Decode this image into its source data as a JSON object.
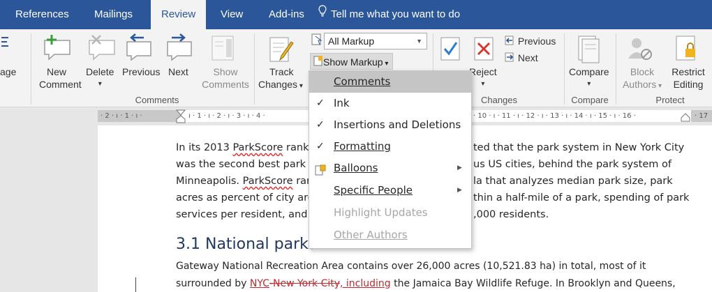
{
  "tabs": [
    {
      "label": "References",
      "active": false
    },
    {
      "label": "Mailings",
      "active": false
    },
    {
      "label": "Review",
      "active": true
    },
    {
      "label": "View",
      "active": false
    },
    {
      "label": "Add-ins",
      "active": false
    }
  ],
  "tell_me": "Tell me what you want to do",
  "ribbon": {
    "page_partial": "age",
    "new_comment": [
      "New",
      "Comment"
    ],
    "delete": "Delete",
    "previous": "Previous",
    "next": "Next",
    "show_comments": [
      "Show",
      "Comments"
    ],
    "comments_group": "Comments",
    "track_changes": [
      "Track",
      "Changes"
    ],
    "markup_select": "All Markup",
    "show_markup": "Show Markup",
    "reject": "Reject",
    "prev_change": "Previous",
    "next_change": "Next",
    "changes_group": "Changes",
    "compare": "Compare",
    "compare_group": "Compare",
    "block_authors": [
      "Block",
      "Authors"
    ],
    "restrict_editing": [
      "Restrict",
      "Editing"
    ],
    "protect_group": "Protect"
  },
  "ruler": {
    "left_numbers": "· 2 · ı · 1 · ı ·",
    "mid_numbers": "ı · 1 · ı · 2 · ı · 3 · ı · 4 ·",
    "right_numbers": "· 10 · ı · 11 · ı · 12 · ı · 13 · ı · 14 · ı · 15 · ı · 16 ·",
    "end_number": "· 17"
  },
  "document": {
    "lines": [
      [
        "In its 2013 ",
        "ParkScore",
        " rankir"
      ],
      [
        "was the second best park sy"
      ],
      [
        "Minneapolis. ",
        "ParkScore",
        " ran"
      ],
      [
        "acres as percent of city area"
      ],
      [
        "services per resident, and t"
      ]
    ],
    "right_lines": [
      "ted that the park system in New York City",
      "us US cities, behind the park system of",
      "la that analyzes median park size, park",
      "thin a half-mile of a park, spending of park",
      ",000 residents."
    ],
    "heading": "3.1 National parks",
    "para2_line1": "Gateway National Recreation Area contains over 26,000 acres (10,521.83 ha) in total, most of it",
    "para2_line2_pre": "surrounded by ",
    "para2_ins1": " NYC",
    "para2_del": "-New York City",
    "para2_mid": ",",
    "para2_ins2": " including",
    "para2_line2_post": " the Jamaica Bay Wildlife Refuge. In Brooklyn and Queens,"
  },
  "menu": {
    "items": [
      {
        "label": "Comments",
        "checked": false,
        "highlighted": true,
        "submenu": false,
        "disabled": false
      },
      {
        "label": "Ink",
        "checked": true,
        "highlighted": false,
        "submenu": false,
        "disabled": false
      },
      {
        "label": "Insertions and Deletions",
        "checked": true,
        "highlighted": false,
        "submenu": false,
        "disabled": false
      },
      {
        "label": "Formatting",
        "checked": true,
        "highlighted": false,
        "submenu": false,
        "disabled": false
      },
      {
        "label": "Balloons",
        "checked": false,
        "highlighted": false,
        "submenu": true,
        "disabled": false
      },
      {
        "label": "Specific People",
        "checked": false,
        "highlighted": false,
        "submenu": true,
        "disabled": false
      },
      {
        "label": "Highlight Updates",
        "checked": false,
        "highlighted": false,
        "submenu": false,
        "disabled": true
      },
      {
        "label": "Other Authors",
        "checked": false,
        "highlighted": false,
        "submenu": false,
        "disabled": true
      }
    ],
    "check_glyph": "✓",
    "arrow_glyph": "▶"
  },
  "colors": {
    "tab_bar": "#2b579a",
    "ribbon": "#f3f3f3",
    "revision": "#c0292f",
    "heading": "#1f3864"
  }
}
